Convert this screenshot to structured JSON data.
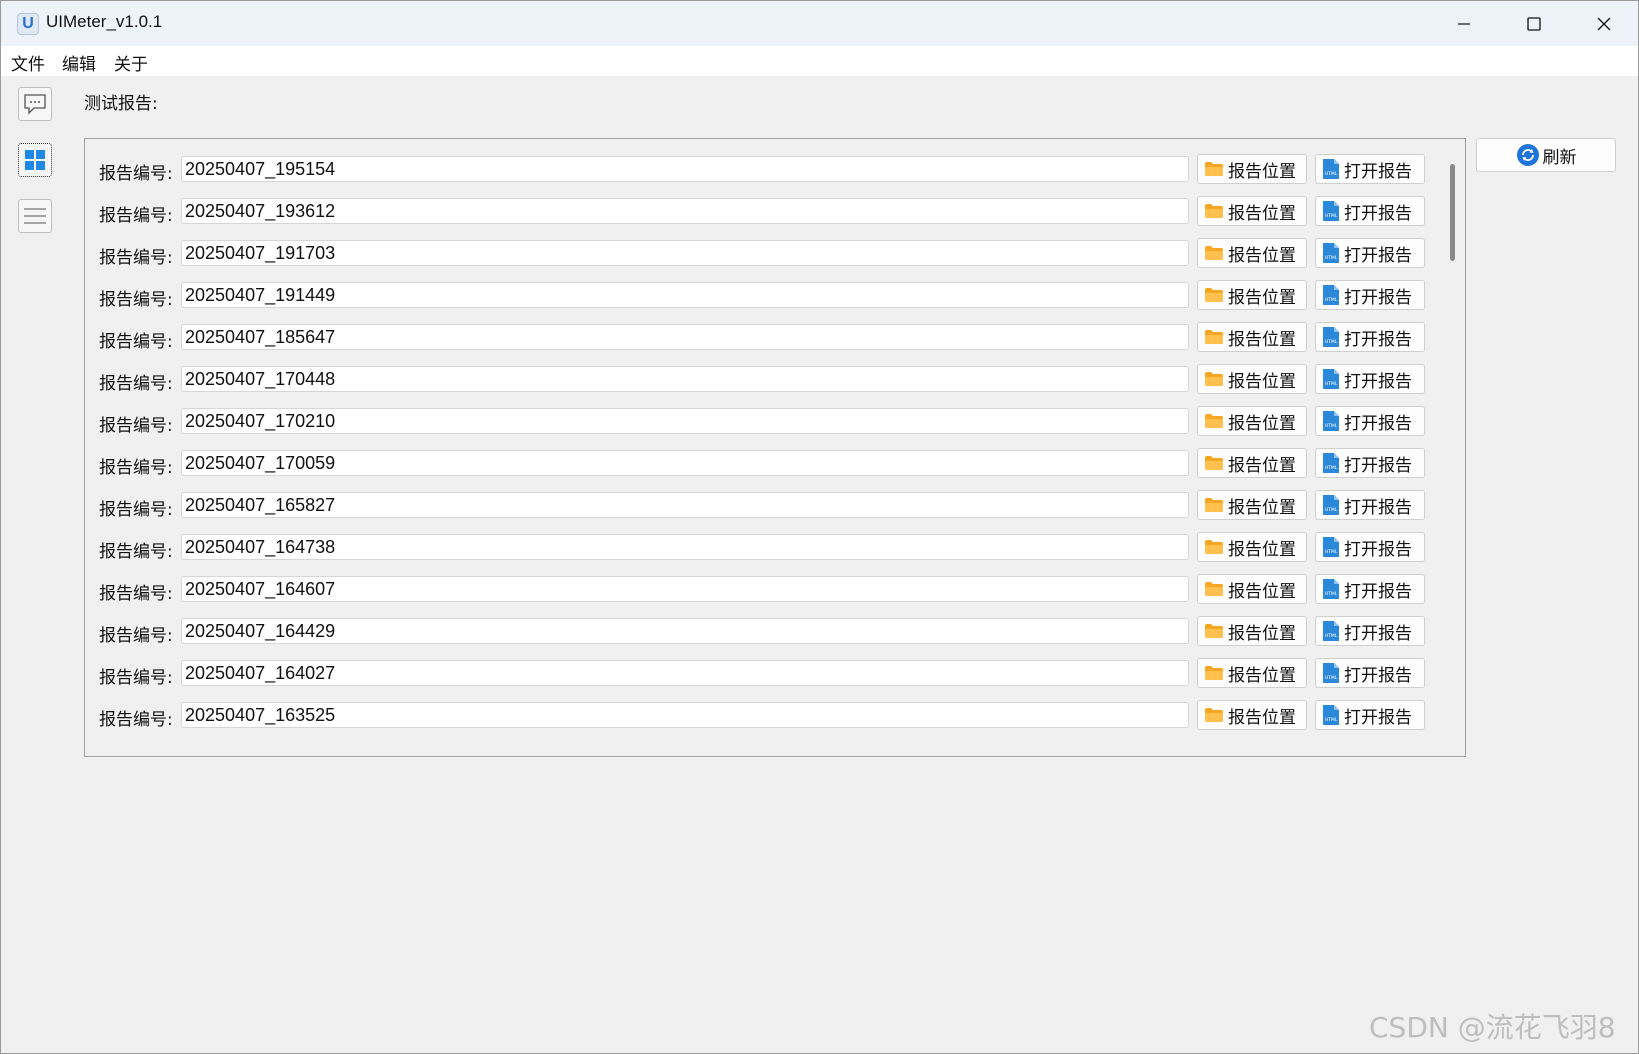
{
  "window": {
    "title": "UIMeter_v1.0.1",
    "icon_letter": "U"
  },
  "menu": [
    "文件",
    "编辑",
    "关于"
  ],
  "sidebar": {
    "buttons": [
      {
        "name": "message-icon"
      },
      {
        "name": "grid-icon"
      },
      {
        "name": "list-icon"
      }
    ]
  },
  "main": {
    "section_label": "测试报告:",
    "refresh_label": "刷新",
    "report_label": "报告编号:",
    "location_label": "报告位置",
    "open_label": "打开报告",
    "open_icon_text": "HTML",
    "reports": [
      "20250407_195154",
      "20250407_193612",
      "20250407_191703",
      "20250407_191449",
      "20250407_185647",
      "20250407_170448",
      "20250407_170210",
      "20250407_170059",
      "20250407_165827",
      "20250407_164738",
      "20250407_164607",
      "20250407_164429",
      "20250407_164027",
      "20250407_163525"
    ]
  },
  "watermark": "CSDN @流花飞羽8",
  "colors": {
    "titlebar": "#eef3fa",
    "folder": "#f5a623",
    "html_file": "#2b88d8",
    "grid_icon": "#1e88e5",
    "refresh_icon": "#1e74d9"
  }
}
